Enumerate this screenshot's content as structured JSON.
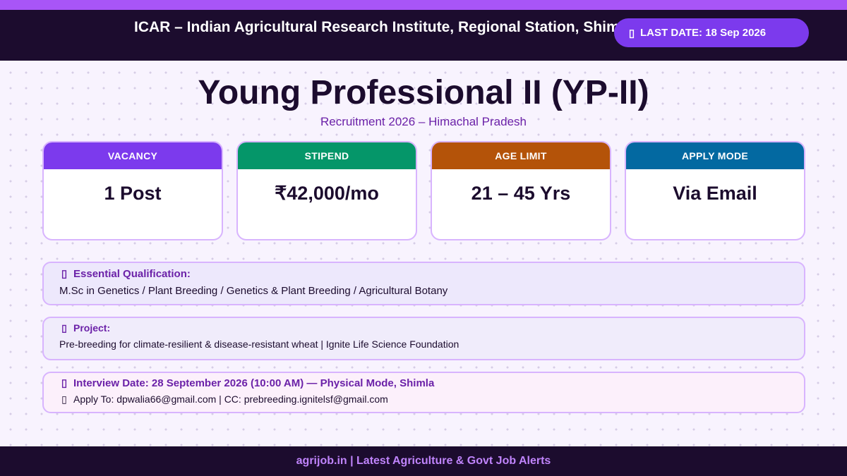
{
  "header": {
    "title": "ICAR – Indian Agricultural Research Institute, Regional Station, Shimla",
    "deadline": {
      "icon": "calendar-icon",
      "text": "LAST DATE: 18 Sep 2026"
    }
  },
  "main": {
    "title": "Young Professional II (YP-II)",
    "subtitle": "Recruitment 2026  –  Himachal Pradesh"
  },
  "cards": [
    {
      "label": "VACANCY",
      "value": "1 Post",
      "color": "#7c3aed"
    },
    {
      "label": "STIPEND",
      "value": "₹42,000/mo",
      "color": "#059669"
    },
    {
      "label": "AGE LIMIT",
      "value": "21 – 45 Yrs",
      "color": "#b45309"
    },
    {
      "label": "APPLY MODE",
      "value": "Via Email",
      "color": "#0369a1"
    }
  ],
  "qualification": {
    "icon": "graduation-cap-icon",
    "label": "Essential Qualification:",
    "text": "M.Sc in Genetics / Plant Breeding / Genetics & Plant Breeding / Agricultural Botany"
  },
  "project": {
    "icon": "microscope-icon",
    "label": "Project:",
    "text": "Pre-breeding for climate-resilient & disease-resistant wheat  |  Ignite Life Science Foundation"
  },
  "interview": {
    "icon": "calendar-icon",
    "label": "Interview Date: 28 September 2026  (10:00 AM) — Physical Mode, Shimla",
    "apply_icon": "mail-icon",
    "apply_text": "Apply To: dpwalia66@gmail.com  |  CC: prebreeding.ignitelsf@gmail.com"
  },
  "footer": {
    "text": "agrijob.in  |  Latest Agriculture & Govt Job Alerts"
  },
  "colors": {
    "brand_dark": "#1c0c2e",
    "accent_purple": "#7c3aed",
    "stripe": "#a855f7"
  }
}
